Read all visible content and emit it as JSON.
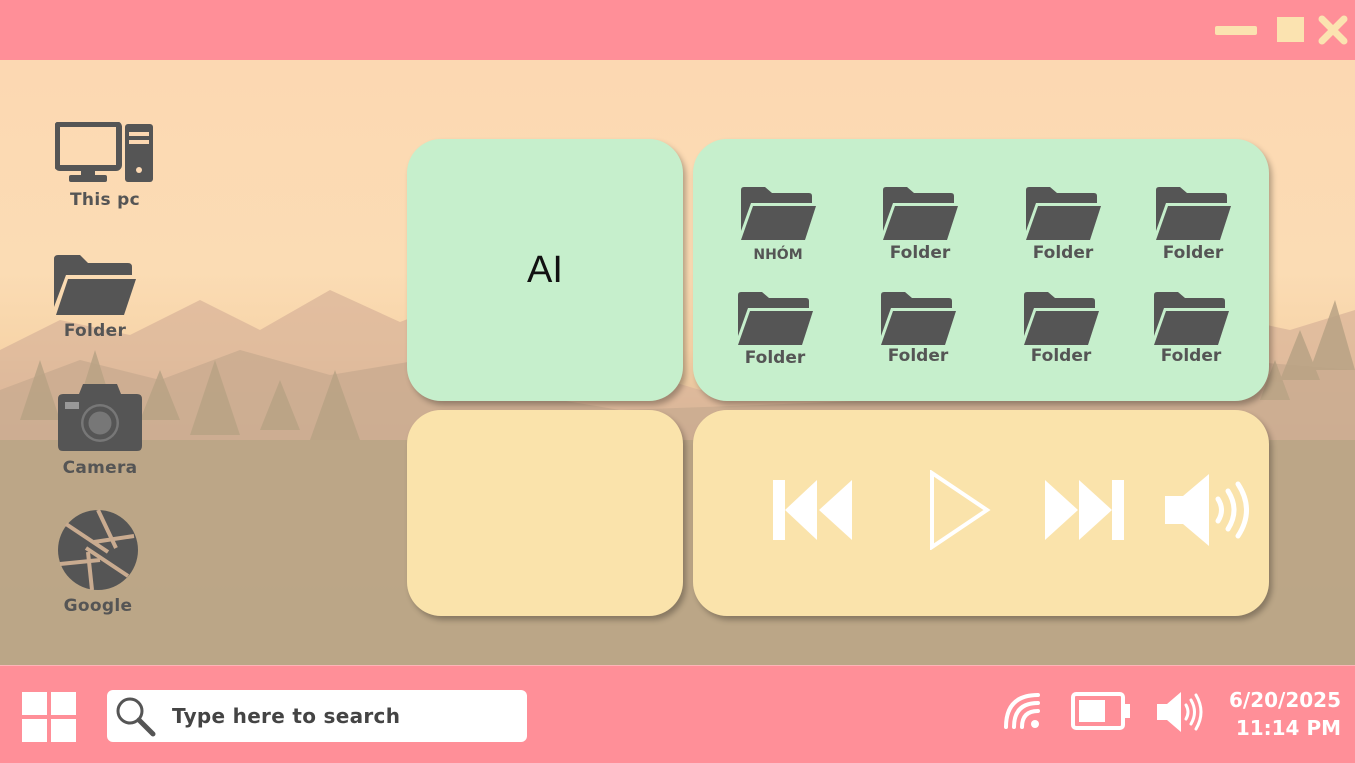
{
  "window": {
    "controls": {
      "minimize_icon": "minimize-icon",
      "maximize_icon": "maximize-icon",
      "close_icon": "close-icon"
    },
    "colors": {
      "titlebar": "#ff8f98",
      "controls": "#fbe3b0"
    }
  },
  "desktop_icons": [
    {
      "label": "This pc",
      "icon": "computer-icon"
    },
    {
      "label": "Folder",
      "icon": "folder-icon"
    },
    {
      "label": "Camera",
      "icon": "camera-icon"
    },
    {
      "label": "Google",
      "icon": "aperture-icon"
    }
  ],
  "tiles": {
    "ai": {
      "label": "AI"
    },
    "folders": [
      {
        "label": "NHÓM"
      },
      {
        "label": "Folder"
      },
      {
        "label": "Folder"
      },
      {
        "label": "Folder"
      },
      {
        "label": "Folder"
      },
      {
        "label": "Folder"
      },
      {
        "label": "Folder"
      },
      {
        "label": "Folder"
      }
    ],
    "media": {
      "buttons": [
        "previous-icon",
        "play-icon",
        "next-icon",
        "volume-icon"
      ]
    },
    "colors": {
      "green": "#c6efcc",
      "yellow": "#fae3ab"
    }
  },
  "taskbar": {
    "search_placeholder": "Type here to search",
    "tray_icons": [
      "wifi-icon",
      "battery-icon",
      "speaker-icon"
    ],
    "date": "6/20/2025",
    "time": "11:14 PM",
    "color": "#ff8f98"
  }
}
